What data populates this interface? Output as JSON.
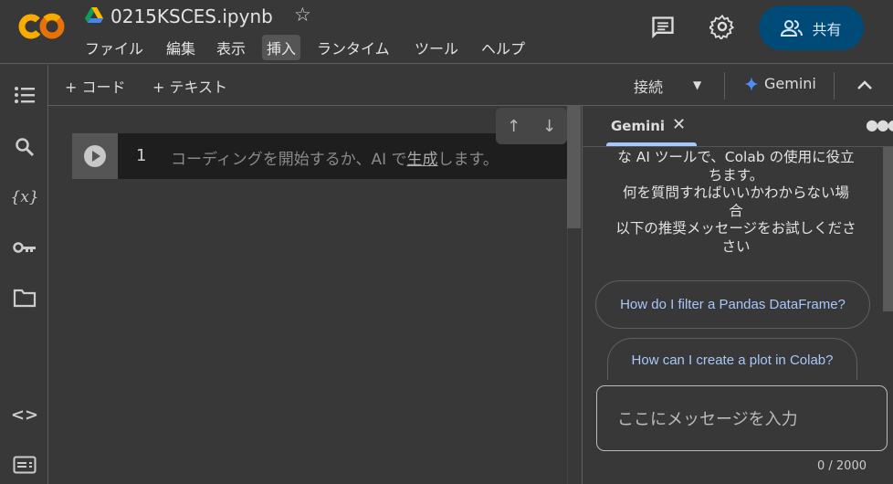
{
  "header": {
    "title": "0215KSCES.ipynb",
    "logo_text": "CO",
    "menu": [
      "ファイル",
      "編集",
      "表示",
      "挿入",
      "ランタイム",
      "ツール",
      "ヘルプ"
    ],
    "active_menu": "挿入",
    "share_label": "共有"
  },
  "toolbar": {
    "add_code": "+ コード",
    "add_text": "+ テキスト",
    "connect": "接続",
    "gemini": "Gemini"
  },
  "cell": {
    "line_number": "1",
    "placeholder_pre": "コーディングを開始するか、AI で",
    "placeholder_link": "生成",
    "placeholder_post": "します。"
  },
  "gemini_panel": {
    "tab_label": "Gemini",
    "intro_lines": [
      "な AI ツールで、Colab の使用に役立",
      "ちます。",
      "何を質問すればいいかわからない場",
      "合",
      "以下の推奨メッセージをお試しくださ",
      "さい"
    ],
    "suggestions": [
      "How do I filter a Pandas DataFrame?",
      "How can I create a plot in Colab?"
    ],
    "input_placeholder": "ここにメッセージを入力",
    "char_count": "0 / 2000"
  },
  "colors": {
    "background": "#383838",
    "share_button": "#004a77",
    "accent": "#a8c7fa",
    "logo_orange": "#f9ab00",
    "logo_dark_orange": "#e8710a"
  }
}
